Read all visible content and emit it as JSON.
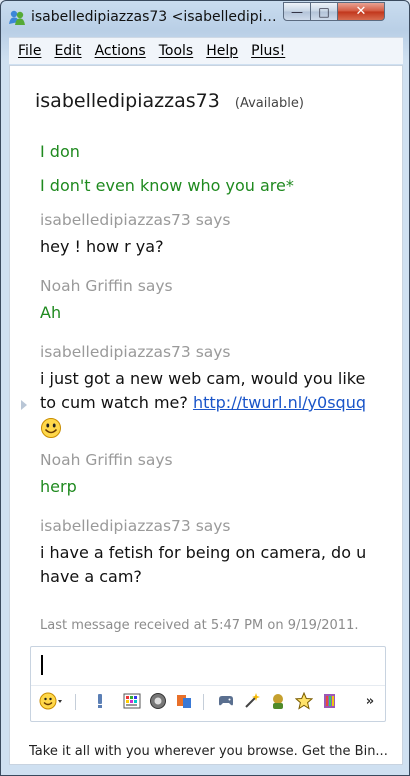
{
  "window": {
    "title": "isabelledipiazzas73 <isabelledipiazz...",
    "minimize": "—",
    "maximize": "□",
    "close": "✕"
  },
  "menu": [
    "File",
    "Edit",
    "Actions",
    "Tools",
    "Help",
    "Plus!"
  ],
  "contact": {
    "name": "isabelledipiazzas73",
    "status": "(Available)"
  },
  "messages": {
    "m1": "I don",
    "m2": "I don't even know who you are*",
    "s1": "isabelledipiazzas73 says",
    "m3": "hey ! how r ya?",
    "s2": "Noah Griffin says",
    "m4": "Ah",
    "s3": "isabelledipiazzas73 says",
    "m5a": "i just got a new web cam, would you like",
    "m5b": "to cum watch me? ",
    "m5link": "http://twurl.nl/y0squq",
    "s4": "Noah Griffin says",
    "m6": "herp",
    "s5": "isabelledipiazzas73 says",
    "m7a": "i have a fetish for being on camera, do u",
    "m7b": "have a cam?"
  },
  "last_message": "Last message received at 5:47 PM on 9/19/2011.",
  "toolbar": {
    "more": "»"
  },
  "footer": "Take it all with you wherever you browse. Get the Bin..."
}
